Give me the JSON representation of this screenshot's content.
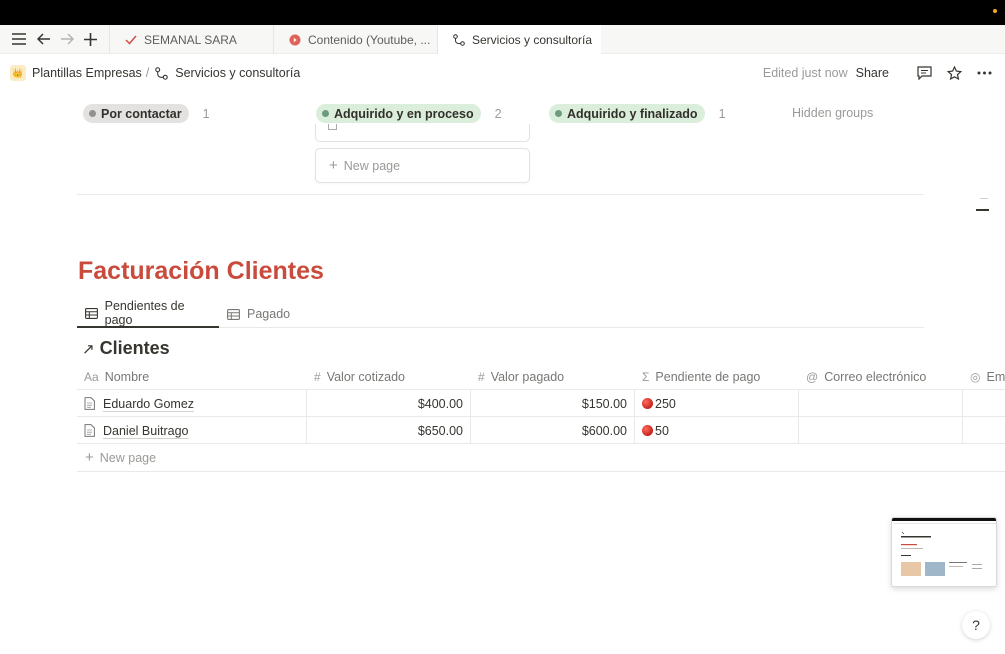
{
  "tabs": [
    {
      "label": "SEMANAL SARA",
      "icon": "check-icon"
    },
    {
      "label": "Contenido (Youtube, ...",
      "icon": "youtube-icon"
    },
    {
      "label": "Servicios y consultoría",
      "icon": "branch-icon"
    }
  ],
  "breadcrumb": {
    "workspace": "Plantillas Empresas",
    "separator": "/",
    "page": "Servicios y consultoría"
  },
  "topbar": {
    "edited": "Edited just now",
    "share": "Share"
  },
  "board": {
    "groups": [
      {
        "label": "Por contactar",
        "count": "1",
        "color": "#e3e2e0"
      },
      {
        "label": "Adquirido y en proceso",
        "count": "2",
        "color": "#dbeddb"
      },
      {
        "label": "Adquirido y finalizado",
        "count": "1",
        "color": "#dbeddb"
      }
    ],
    "hidden_groups": "Hidden groups",
    "new_page": "New page"
  },
  "section": {
    "title": "Facturación Clientes",
    "views": [
      {
        "label": "Pendientes de pago"
      },
      {
        "label": "Pagado"
      }
    ],
    "db_title": "Clientes"
  },
  "table": {
    "columns": [
      {
        "icon": "Aa",
        "label": "Nombre"
      },
      {
        "icon": "#",
        "label": "Valor cotizado"
      },
      {
        "icon": "#",
        "label": "Valor pagado"
      },
      {
        "icon": "Σ",
        "label": "Pendiente de pago"
      },
      {
        "icon": "@",
        "label": "Correo electrónico"
      },
      {
        "icon": "◎",
        "label": "Em"
      }
    ],
    "rows": [
      {
        "name": "Eduardo Gomez",
        "cotizado": "$400.00",
        "pagado": "$150.00",
        "pendiente": "250",
        "correo": ""
      },
      {
        "name": "Daniel Buitrago",
        "cotizado": "$650.00",
        "pagado": "$600.00",
        "pendiente": "50",
        "correo": ""
      }
    ],
    "new_page": "New page"
  },
  "colors": {
    "title_red": "#c84b3c",
    "status_green": "#dbeddb",
    "status_gray": "#e3e2e0"
  }
}
